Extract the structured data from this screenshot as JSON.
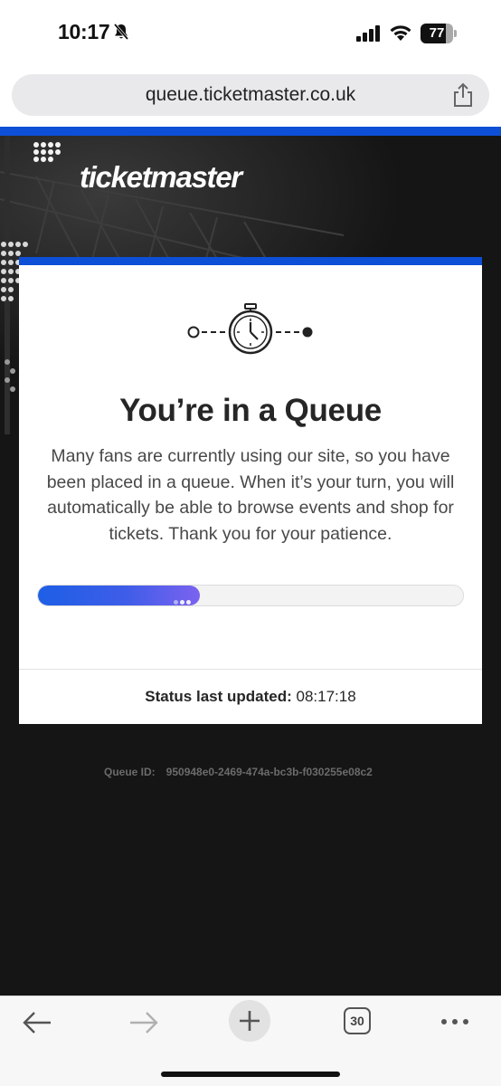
{
  "status_bar": {
    "time": "10:17",
    "battery_percent": "77",
    "battery_level": 0.77,
    "icons": [
      "bell-slash-icon",
      "cellular-signal-icon",
      "wifi-icon",
      "battery-icon"
    ]
  },
  "browser": {
    "url": "queue.ticketmaster.co.uk",
    "share_icon": "share-icon"
  },
  "page": {
    "logo": "ticketmaster",
    "accent_color": "#0d4fd6",
    "card": {
      "icon": "stopwatch-queue-icon",
      "title": "You’re in a Queue",
      "message": "Many fans are currently using our site, so you have been placed in a queue. When it’s your turn, you will automatically be able to browse events and shop for tickets. Thank you for your patience.",
      "progress": 0.38,
      "status_label": "Status last updated:",
      "status_time": "08:17:18"
    },
    "queue_id_label": "Queue ID:",
    "queue_id_value": "950948e0-2469-474a-bc3b-f030255e08c2"
  },
  "toolbar": {
    "back_icon": "back-arrow-icon",
    "forward_icon": "forward-arrow-icon",
    "new_tab_icon": "plus-icon",
    "tab_count": "30",
    "more_icon": "more-dots-icon"
  }
}
